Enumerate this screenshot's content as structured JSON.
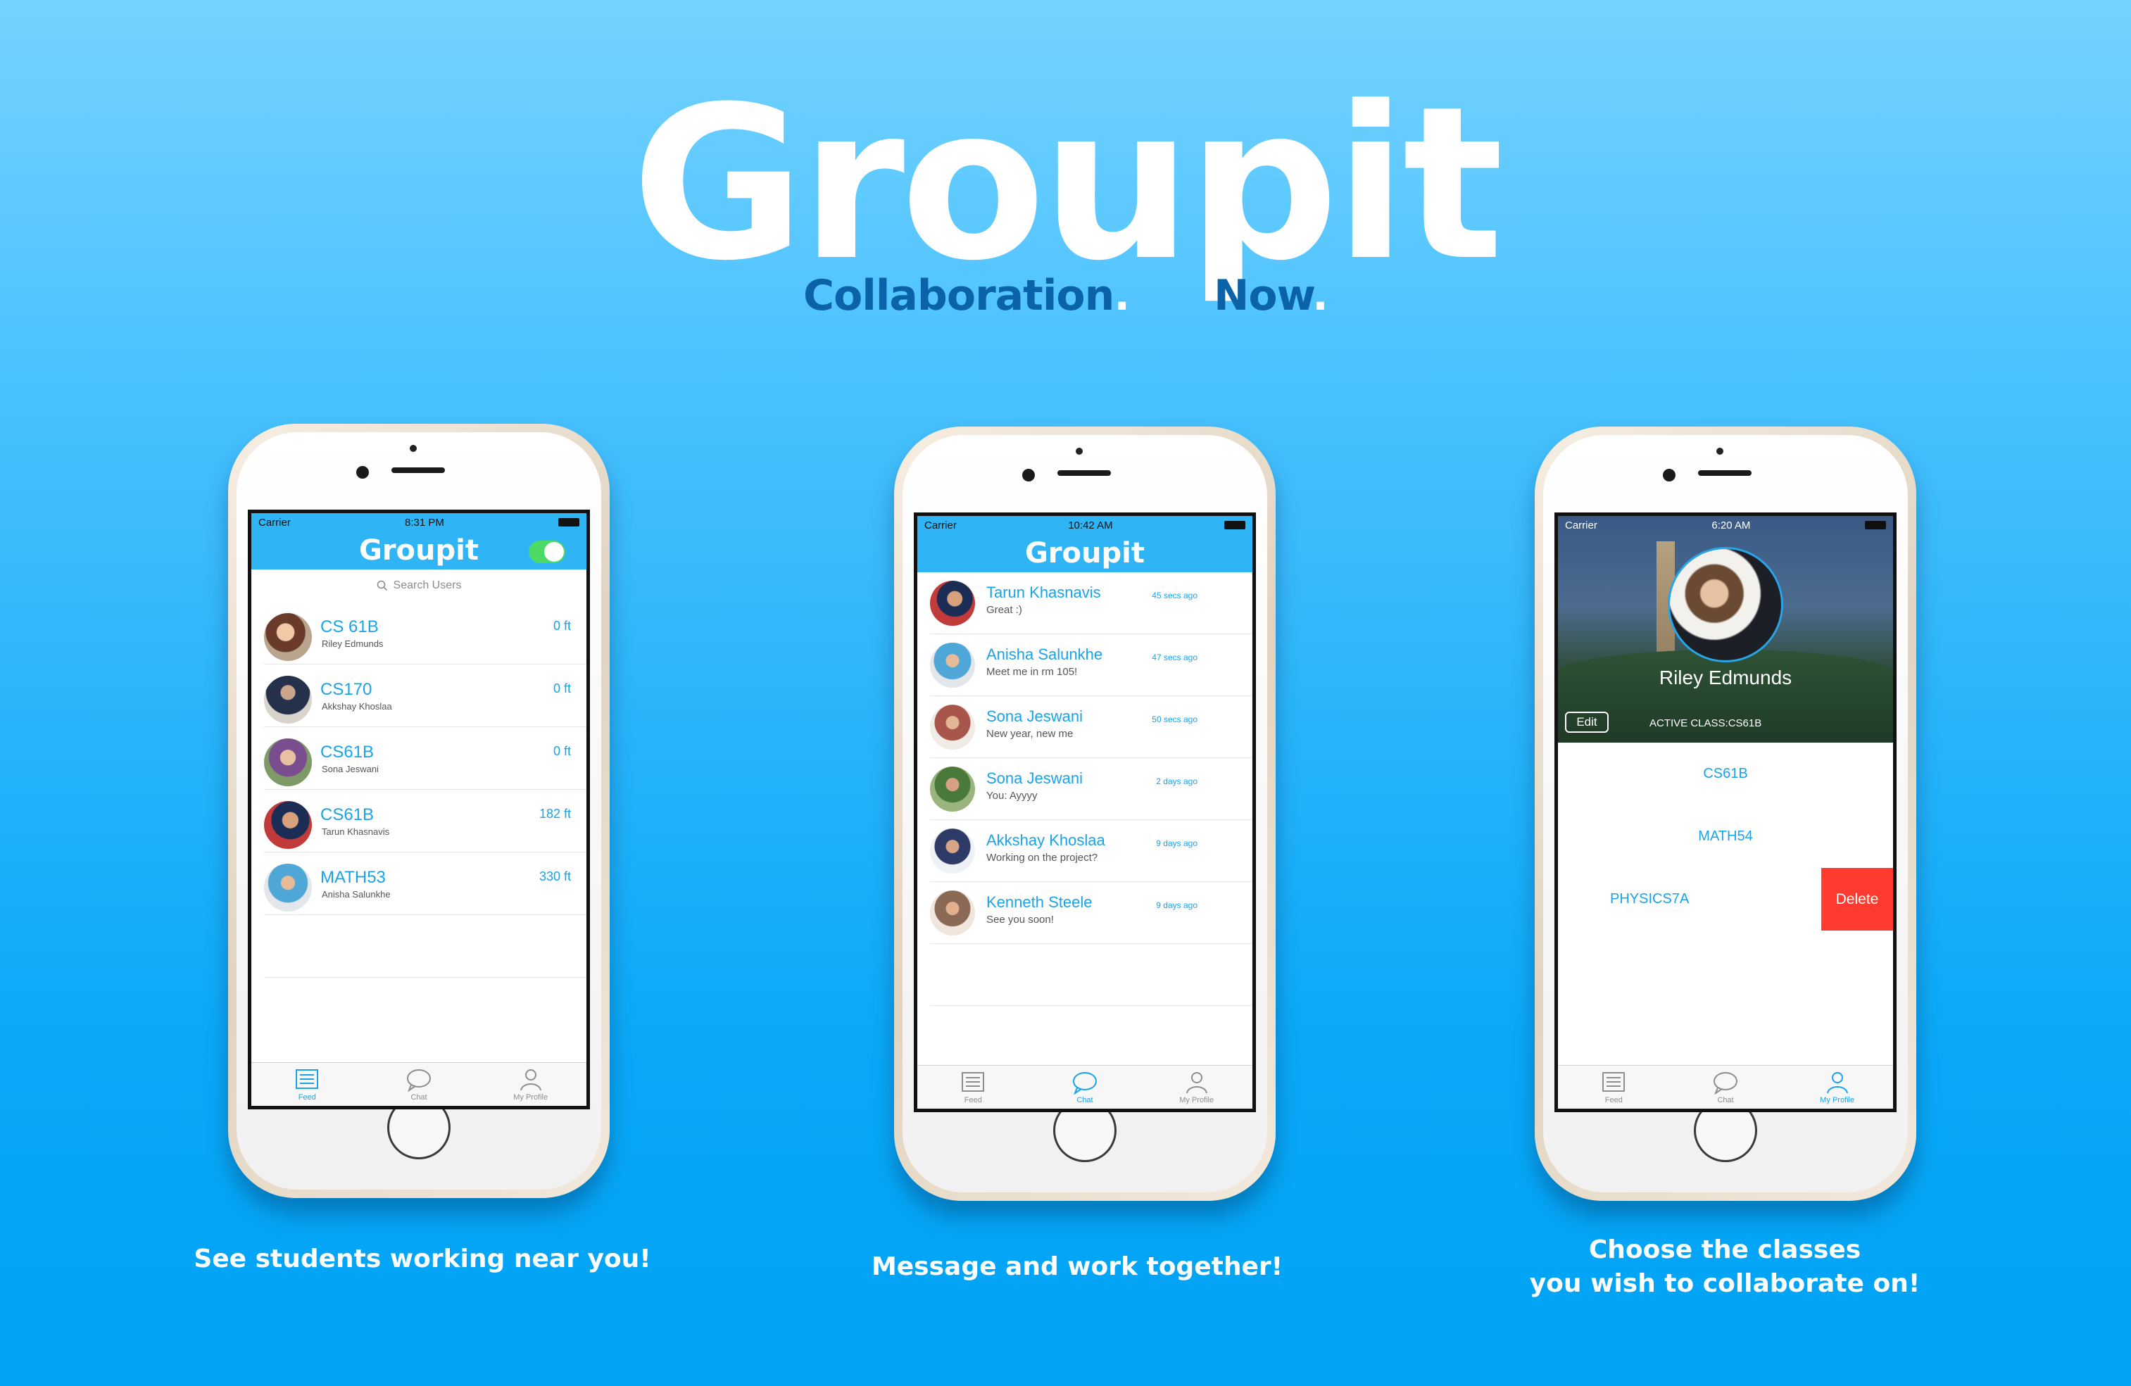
{
  "brand": {
    "title": "Groupit",
    "tagline_left": "Collaboration",
    "tagline_right": "Now",
    "dot": "."
  },
  "colors": {
    "accent": "#1aa3e8",
    "nav_blue": "#2fb5f5",
    "toggle_on": "#4cd964",
    "delete_red": "#ff3b30",
    "tagline": "#0a63a9"
  },
  "phone1": {
    "status": {
      "carrier": "Carrier",
      "time": "8:31 PM"
    },
    "title": "Groupit",
    "search_placeholder": "Search Users",
    "rows": [
      {
        "title": "CS 61B",
        "sub": "Riley Edmunds",
        "dist": "0 ft"
      },
      {
        "title": "CS170",
        "sub": "Akkshay Khoslaa",
        "dist": "0 ft"
      },
      {
        "title": "CS61B",
        "sub": "Sona Jeswani",
        "dist": "0 ft"
      },
      {
        "title": "CS61B",
        "sub": "Tarun Khasnavis",
        "dist": "182 ft"
      },
      {
        "title": "MATH53",
        "sub": "Anisha Salunkhe",
        "dist": "330 ft"
      }
    ],
    "tabs": [
      "Feed",
      "Chat",
      "My Profile"
    ],
    "active_tab": "Feed",
    "caption": "See students working near you!"
  },
  "phone2": {
    "status": {
      "carrier": "Carrier",
      "time": "10:42 AM"
    },
    "title": "Groupit",
    "rows": [
      {
        "name": "Tarun Khasnavis",
        "msg": "Great :)",
        "time": "45 secs ago"
      },
      {
        "name": "Anisha Salunkhe",
        "msg": "Meet me in rm 105!",
        "time": "47 secs ago"
      },
      {
        "name": "Sona Jeswani",
        "msg": "New year, new me",
        "time": "50 secs ago"
      },
      {
        "name": "Sona Jeswani",
        "msg": "You: Ayyyy",
        "time": "2 days ago"
      },
      {
        "name": "Akkshay Khoslaa",
        "msg": "Working on the project?",
        "time": "9 days ago"
      },
      {
        "name": "Kenneth Steele",
        "msg": "See you soon!",
        "time": "9 days ago"
      }
    ],
    "tabs": [
      "Feed",
      "Chat",
      "My Profile"
    ],
    "active_tab": "Chat",
    "caption": "Message and work together!"
  },
  "phone3": {
    "status": {
      "carrier": "Carrier",
      "time": "6:20 AM"
    },
    "name": "Riley Edmunds",
    "edit_label": "Edit",
    "active_class": "ACTIVE CLASS:CS61B",
    "classes": [
      "CS61B",
      "MATH54",
      "PHYSICS7A"
    ],
    "delete_label": "Delete",
    "tabs": [
      "Feed",
      "Chat",
      "My Profile"
    ],
    "active_tab": "My Profile",
    "caption_line1": "Choose the classes",
    "caption_line2": "you wish to collaborate on!"
  }
}
